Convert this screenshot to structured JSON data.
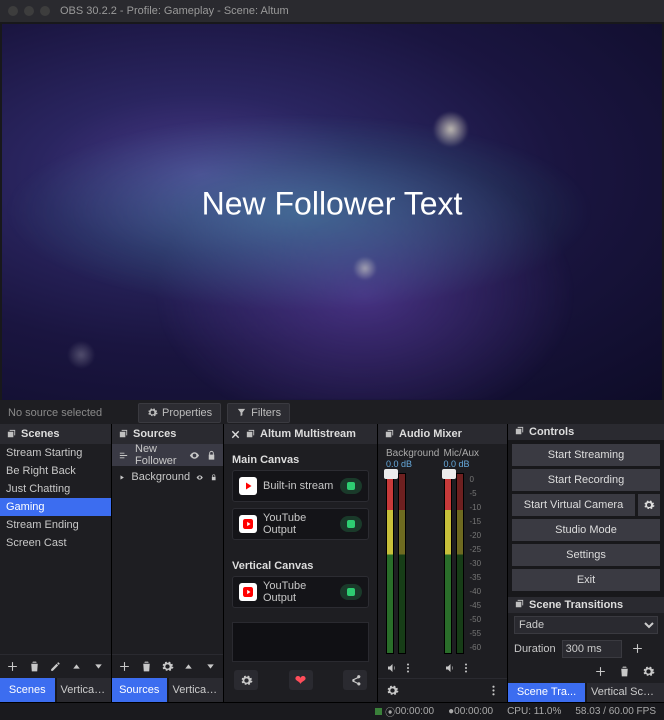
{
  "titlebar": "OBS 30.2.2 - Profile: Gameplay - Scene: Altum",
  "preview": {
    "overlay_text": "New Follower Text"
  },
  "propbar": {
    "label": "No source selected",
    "properties": "Properties",
    "filters": "Filters"
  },
  "docks": {
    "scenes": {
      "title": "Scenes",
      "items": [
        "Stream Starting",
        "Be Right Back",
        "Just Chatting",
        "Gaming",
        "Stream Ending",
        "Screen Cast"
      ],
      "selected": 3,
      "tabs": [
        "Scenes",
        "Vertical Scen..."
      ]
    },
    "sources": {
      "title": "Sources",
      "items": [
        {
          "name": "New Follower",
          "visible": true,
          "locked": true,
          "selected": true,
          "icon": "group"
        },
        {
          "name": "Background",
          "visible": true,
          "locked": true,
          "selected": false,
          "icon": "play"
        }
      ],
      "tabs": [
        "Sources",
        "Vertical Sour..."
      ]
    },
    "multistream": {
      "title": "Altum Multistream",
      "main_title": "Main Canvas",
      "vertical_title": "Vertical Canvas",
      "main": [
        {
          "icon": "play",
          "label": "Built-in stream"
        },
        {
          "icon": "yt",
          "label": "YouTube Output"
        }
      ],
      "vertical": [
        {
          "icon": "yt",
          "label": "YouTube Output"
        }
      ]
    },
    "mixer": {
      "title": "Audio Mixer",
      "tracks": [
        {
          "name": "Background",
          "db": "0.0 dB"
        },
        {
          "name": "Mic/Aux",
          "db": "0.0 dB"
        }
      ],
      "scale": [
        "0",
        "-5",
        "-10",
        "-15",
        "-20",
        "-25",
        "-30",
        "-35",
        "-40",
        "-45",
        "-50",
        "-55",
        "-60"
      ]
    },
    "controls": {
      "title": "Controls",
      "buttons": [
        "Start Streaming",
        "Start Recording",
        "Start Virtual Camera",
        "Studio Mode",
        "Settings",
        "Exit"
      ],
      "transitions_title": "Scene Transitions",
      "transition_type": "Fade",
      "duration_label": "Duration",
      "duration_value": "300 ms",
      "tabs": [
        "Scene Tra...",
        "Vertical Scene Tra..."
      ]
    }
  },
  "status": {
    "live_time": "00:00:00",
    "rec_time": "00:00:00",
    "cpu": "CPU: 11.0%",
    "fps": "58.03 / 60.00 FPS"
  }
}
